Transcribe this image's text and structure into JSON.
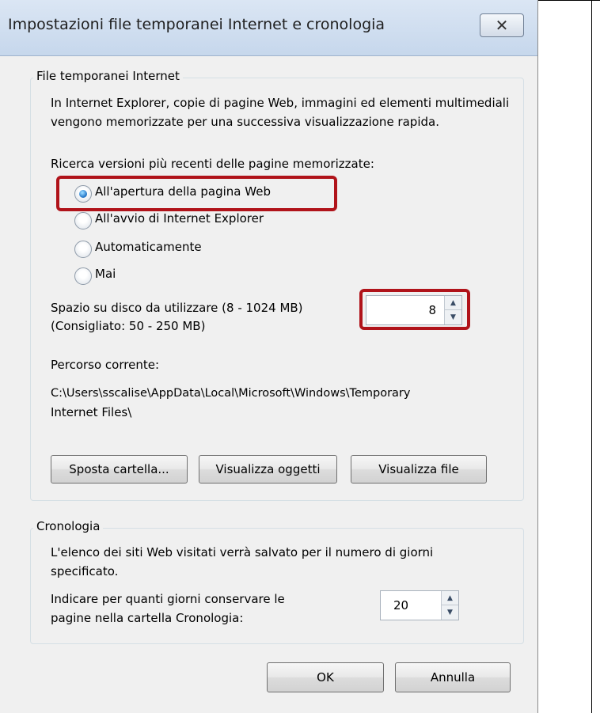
{
  "window": {
    "title": "Impostazioni file temporanei Internet e cronologia",
    "close_icon": "close-icon"
  },
  "temp_files": {
    "legend": "File temporanei Internet",
    "description": "In Internet Explorer, copie di pagine Web, immagini ed elementi multimediali vengono memorizzate per una successiva visualizzazione rapida.",
    "check_label": "Ricerca versioni più recenti delle pagine memorizzate:",
    "options": [
      {
        "label": "All'apertura della pagina Web",
        "selected": true
      },
      {
        "label": "All'avvio di Internet Explorer",
        "selected": false
      },
      {
        "label": "Automaticamente",
        "selected": false
      },
      {
        "label": "Mai",
        "selected": false
      }
    ],
    "disk_space_label": "Spazio su disco da utilizzare (8 - 1024 MB)",
    "disk_space_hint": "(Consigliato: 50 - 250 MB)",
    "disk_space_value": "8",
    "current_path_label": "Percorso corrente:",
    "current_path_line1": "C:\\Users\\sscalise\\AppData\\Local\\Microsoft\\Windows\\Temporary",
    "current_path_line2": "Internet Files\\",
    "buttons": {
      "move_folder": "Sposta cartella...",
      "view_objects": "Visualizza oggetti",
      "view_files": "Visualizza file"
    }
  },
  "history": {
    "legend": "Cronologia",
    "description": "L'elenco dei siti Web visitati verrà salvato per il numero di giorni specificato.",
    "days_label_line1": "Indicare per quanti giorni conservare le",
    "days_label_line2": "pagine nella cartella Cronologia:",
    "days_value": "20"
  },
  "footer": {
    "ok": "OK",
    "cancel": "Annulla"
  },
  "colors": {
    "highlight": "#b0131a",
    "dialog_bg": "#f0f0f0",
    "titlebar": "#c6d7ec"
  }
}
